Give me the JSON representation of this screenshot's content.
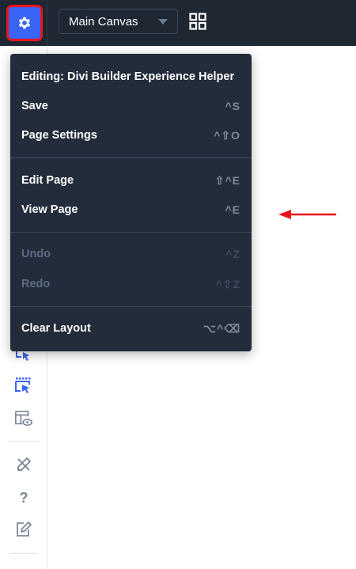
{
  "topbar": {
    "canvas_select": {
      "value": "Main Canvas"
    },
    "settings_icon": "gear-icon",
    "grid_icon": "grid-icon"
  },
  "menu": {
    "header": "Editing: Divi Builder Experience Helper",
    "groups": [
      [
        {
          "label": "Save",
          "shortcut": "^S",
          "disabled": false
        },
        {
          "label": "Page Settings",
          "shortcut": "^⇧O",
          "disabled": false
        }
      ],
      [
        {
          "label": "Edit Page",
          "shortcut": "⇧^E",
          "disabled": false
        },
        {
          "label": "View Page",
          "shortcut": "^E",
          "disabled": false
        }
      ],
      [
        {
          "label": "Undo",
          "shortcut": "^Z",
          "disabled": true
        },
        {
          "label": "Redo",
          "shortcut": "^⇧Z",
          "disabled": true
        }
      ],
      [
        {
          "label": "Clear Layout",
          "shortcut": "⌥^⌫",
          "disabled": false
        }
      ]
    ]
  },
  "sidebar": {
    "icons": [
      "select-cursor-icon",
      "multi-select-icon",
      "preview-layout-icon",
      "tools-icon",
      "help-icon",
      "edit-icon"
    ],
    "help_label": "?"
  },
  "colors": {
    "topbar_bg": "#1f2733",
    "menu_bg": "#232c3a",
    "accent": "#3a64f5",
    "highlight": "#e8141b"
  }
}
